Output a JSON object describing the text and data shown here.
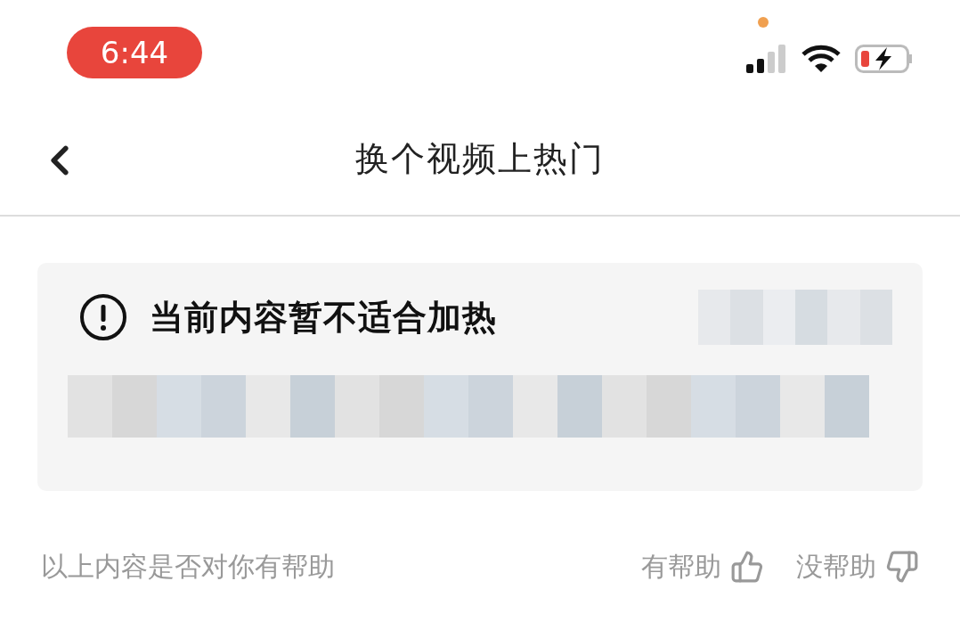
{
  "status_bar": {
    "time": "6:44"
  },
  "nav": {
    "title": "换个视频上热门"
  },
  "notice": {
    "title": "当前内容暂不适合加热"
  },
  "feedback": {
    "question": "以上内容是否对你有帮助",
    "options": [
      {
        "label": "有帮助",
        "kind": "up"
      },
      {
        "label": "没帮助",
        "kind": "down"
      }
    ]
  }
}
